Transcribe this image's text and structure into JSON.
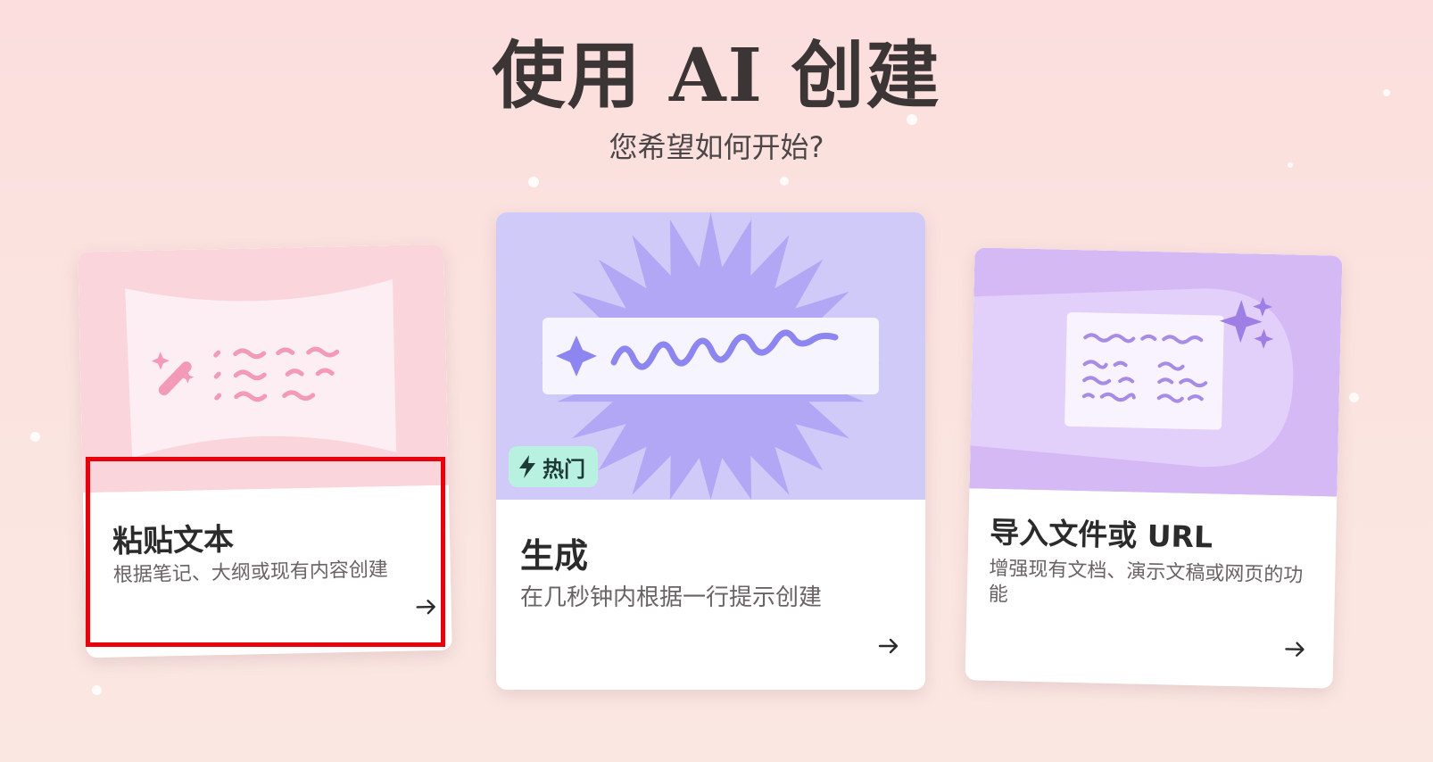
{
  "header": {
    "title": "使用 AI 创建",
    "subtitle": "您希望如何开始?"
  },
  "cards": [
    {
      "title": "粘贴文本",
      "description": "根据笔记、大纲或现有内容创建",
      "icon": "magic-wand-icon",
      "accent": "#fbd2db"
    },
    {
      "title": "生成",
      "description": "在几秒钟内根据一行提示创建",
      "badge": "热门",
      "icon": "sparkle-icon",
      "accent": "#b7adf6"
    },
    {
      "title": "导入文件或 URL",
      "description": "增强现有文档、演示文稿或网页的功能",
      "icon": "sparkles-icon",
      "accent": "#d6b8f3"
    }
  ],
  "colors": {
    "background": "#fbe3df",
    "badge_bg": "#b9f1e1",
    "highlight": "#e8000a"
  }
}
